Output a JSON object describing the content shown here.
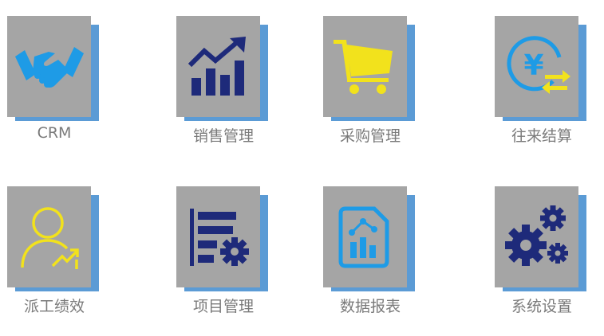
{
  "modules": [
    {
      "label": "CRM",
      "icon": "handshake-icon",
      "color": "#1e9be6"
    },
    {
      "label": "销售管理",
      "icon": "sales-chart-icon",
      "color": "#1e2a7a"
    },
    {
      "label": "采购管理",
      "icon": "shopping-cart-icon",
      "color": "#f2e21c"
    },
    {
      "label": "往来结算",
      "icon": "yen-exchange-icon",
      "color": "#1e9be6"
    },
    {
      "label": "派工绩效",
      "icon": "user-performance-icon",
      "color": "#f2e21c"
    },
    {
      "label": "项目管理",
      "icon": "project-settings-icon",
      "color": "#1e2a7a"
    },
    {
      "label": "数据报表",
      "icon": "data-report-icon",
      "color": "#1e9be6"
    },
    {
      "label": "系统设置",
      "icon": "system-gears-icon",
      "color": "#1e2a7a"
    }
  ]
}
